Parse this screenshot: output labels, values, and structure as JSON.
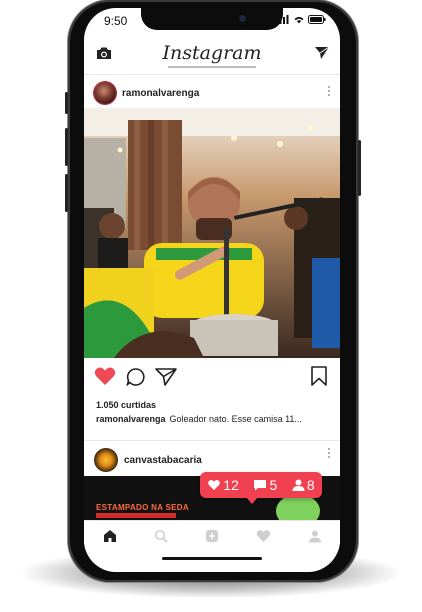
{
  "status_bar": {
    "time": "9:50"
  },
  "header": {
    "logo_text": "Instagram",
    "left_icon": "camera-icon",
    "right_icon": "send-icon"
  },
  "post": {
    "username": "ramonalvarenga",
    "likes_text": "1.050 curtidas",
    "caption_user": "ramonalvarenga",
    "caption_text": "Goleador nato. Esse camisa 11...",
    "liked": true
  },
  "post2": {
    "username": "canvastabacaria",
    "image_text": "ESTAMPADO NA SEDA"
  },
  "notification": {
    "likes": "12",
    "comments": "5",
    "followers": "8",
    "color": "#f1404f"
  },
  "tabs": [
    {
      "icon": "home-icon"
    },
    {
      "icon": "search-icon"
    },
    {
      "icon": "add-icon"
    },
    {
      "icon": "heart-icon"
    },
    {
      "icon": "profile-icon"
    }
  ],
  "colors": {
    "like": "#ed4956",
    "text": "#222222"
  }
}
